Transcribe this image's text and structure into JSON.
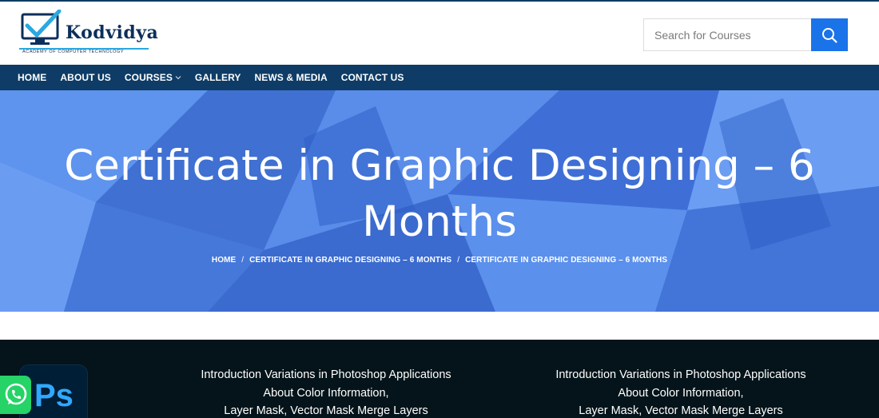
{
  "brand": {
    "name": "Kodvidya",
    "tagline": "ACADEMY OF COMPUTER TECHNOLOGY"
  },
  "search": {
    "placeholder": "Search for Courses",
    "button_icon": "search-icon"
  },
  "nav": {
    "items": [
      {
        "label": "HOME"
      },
      {
        "label": "ABOUT US"
      },
      {
        "label": "COURSES",
        "has_dropdown": true
      },
      {
        "label": "GALLERY"
      },
      {
        "label": "NEWS & MEDIA"
      },
      {
        "label": "CONTACT US"
      }
    ]
  },
  "hero": {
    "title": "Certificate in Graphic Designing – 6 Months",
    "breadcrumb": [
      "HOME",
      "CERTIFICATE IN GRAPHIC DESIGNING – 6 MONTHS",
      "CERTIFICATE IN GRAPHIC DESIGNING – 6 MONTHS"
    ],
    "separator": "/"
  },
  "content": {
    "columns": [
      {
        "lines": [
          "Introduction Variations in Photoshop Applications",
          "About Color Information,",
          "Layer Mask, Vector Mask Merge Layers"
        ]
      },
      {
        "lines": [
          "Introduction Variations in Photoshop Applications",
          "About Color Information,",
          "Layer Mask, Vector Mask Merge Layers"
        ]
      }
    ],
    "app_icon": {
      "label": "Ps",
      "name": "photoshop-icon"
    }
  },
  "colors": {
    "nav_bg": "#0e3c66",
    "accent": "#1a73e8",
    "hero_bg": "#4a7fe0",
    "dark_bg": "#04141a",
    "whatsapp": "#25d366"
  },
  "floating": {
    "whatsapp_icon": "whatsapp-icon"
  }
}
